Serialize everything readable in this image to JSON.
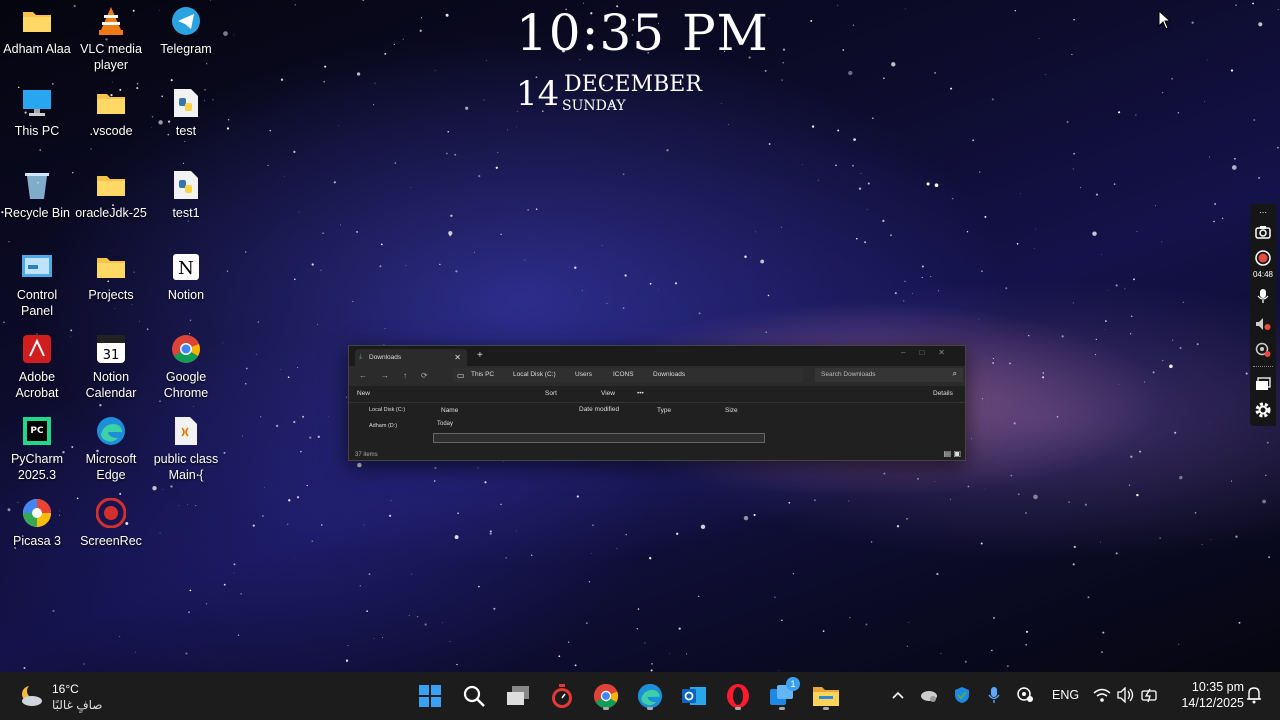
{
  "desktop": {
    "icons": [
      {
        "label": "Adham Alaa",
        "icon": "folder-icon"
      },
      {
        "label": "VLC media player",
        "icon": "vlc-icon"
      },
      {
        "label": "Telegram",
        "icon": "telegram-icon"
      },
      {
        "label": "This PC",
        "icon": "monitor-icon"
      },
      {
        "label": ".vscode",
        "icon": "folder-icon"
      },
      {
        "label": "test",
        "icon": "python-file-icon"
      },
      {
        "label": "Recycle Bin",
        "icon": "recycle-bin-icon"
      },
      {
        "label": "oracleJdk-25",
        "icon": "folder-icon"
      },
      {
        "label": "test1",
        "icon": "python-file-icon"
      },
      {
        "label": "Control Panel",
        "icon": "control-panel-icon"
      },
      {
        "label": "Projects",
        "icon": "folder-icon"
      },
      {
        "label": "Notion",
        "icon": "notion-icon"
      },
      {
        "label": "Adobe Acrobat",
        "icon": "acrobat-icon"
      },
      {
        "label": "Notion Calendar",
        "icon": "notion-calendar-icon"
      },
      {
        "label": "Google Chrome",
        "icon": "chrome-icon"
      },
      {
        "label": "PyCharm 2025.3",
        "icon": "pycharm-icon"
      },
      {
        "label": "Microsoft Edge",
        "icon": "edge-icon"
      },
      {
        "label": "public class Main {",
        "icon": "java-file-icon"
      },
      {
        "label": "Picasa 3",
        "icon": "picasa-icon"
      },
      {
        "label": "ScreenRec",
        "icon": "screenrec-icon"
      }
    ]
  },
  "clock_widget": {
    "time": "10:35 PM",
    "day": "14",
    "month": "DECEMBER",
    "weekday": "SUNDAY"
  },
  "explorer": {
    "tab_title": "Downloads",
    "breadcrumbs": [
      "This PC",
      "Local Disk (C:)",
      "Users",
      "ICONS",
      "Downloads"
    ],
    "search_placeholder": "Search Downloads",
    "toolbar": {
      "new": "New",
      "sort": "Sort",
      "view": "View",
      "more": "•••",
      "details": "Details"
    },
    "nav_items": [
      "Local Disk (C:)",
      "Adham (D:)"
    ],
    "columns": [
      "Name",
      "Date modified",
      "Type",
      "Size"
    ],
    "group": "Today",
    "status": "37 items"
  },
  "recorder": {
    "timer": "04:48"
  },
  "taskbar": {
    "weather": {
      "temp": "16°C",
      "condition": "صافٍ غالبًا"
    },
    "apps": [
      {
        "icon": "start-icon",
        "running": false
      },
      {
        "icon": "search-icon",
        "running": false
      },
      {
        "icon": "task-view-icon",
        "running": false
      },
      {
        "icon": "stopwatch-icon",
        "running": false
      },
      {
        "icon": "chrome-icon",
        "running": true
      },
      {
        "icon": "edge-icon",
        "running": true
      },
      {
        "icon": "outlook-icon",
        "running": false
      },
      {
        "icon": "opera-icon",
        "running": true
      },
      {
        "icon": "chat-icon",
        "running": true,
        "badge": "1"
      },
      {
        "icon": "file-explorer-icon",
        "running": true
      }
    ],
    "language": "ENG",
    "time": "10:35 pm",
    "date": "14/12/2025"
  }
}
